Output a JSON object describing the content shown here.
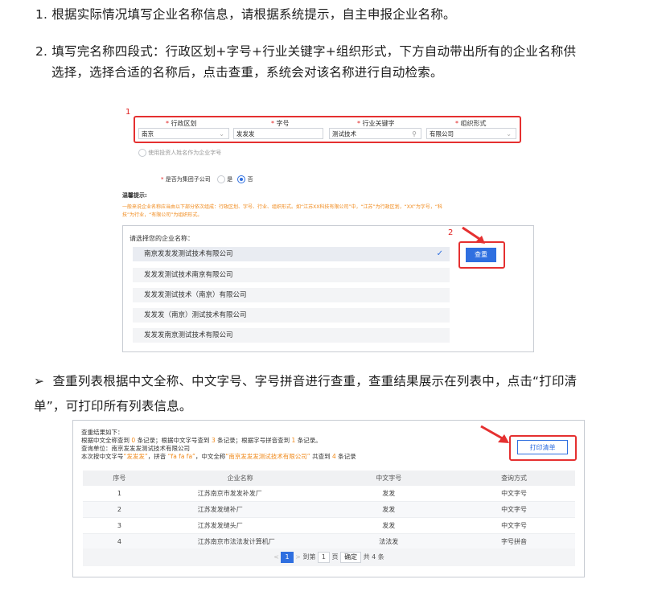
{
  "step1": "1. 根据实际情况填写企业名称信息，请根据系统提示，自主申报企业名称。",
  "step2_line1": "2. 填写完名称四段式：行政区划+字号+行业关键字+组织形式，下方自动带出所有的企业名称供",
  "step2_line2": "选择，选择合适的名称后，点击查重，系统会对该名称进行自动检索。",
  "fig1": {
    "marker1": "1",
    "marker2": "2",
    "asterisk": "*",
    "labels": [
      "行政区划",
      "字号",
      "行业关键字",
      "组织形式"
    ],
    "values": [
      "南京",
      "发发发",
      "测试技术",
      "有限公司"
    ],
    "investor_option": "使用投资人姓名作为企业字号",
    "group_label": "是否为集团子公司",
    "group_yes": "是",
    "group_no": "否",
    "tip_title": "温馨提示:",
    "tip_line1": "一般来说企业名称应当由以下部分依次组成：行政区划、字号、行业、组织形式。如“江苏XX科技有限公司”中，“江苏”为行政区划，“XX”为字号，“科",
    "tip_line2": "技”为行业，“有限公司”为组织形式。",
    "choose_label": "请选择您的企业名称：",
    "names": [
      "南京发发发测试技术有限公司",
      "发发发测试技术南京有限公司",
      "发发发测试技术（南京）有限公司",
      "发发发（南京）测试技术有限公司",
      "发发发南京测试技术有限公司"
    ],
    "check_button": "查重"
  },
  "bullet": "➢",
  "bullet_line1": "查重列表根据中文全称、中文字号、字号拼音进行查重，查重结果展示在列表中，点击“打印清",
  "bullet_line2": "单”，可打印所有列表信息。",
  "fig2": {
    "title": "查重结果如下：",
    "line2_a": "根据中文全称查到",
    "line2_n1": "0",
    "line2_b": "条记录；根据中文字号查到",
    "line2_n2": "3",
    "line2_c": "条记录；根据字号拼音查到",
    "line2_n3": "1",
    "line2_d": "条记录。",
    "unit": "查询单位：南京发发发测试技术有限公司",
    "line4_a": "本次按中文字号",
    "line4_q1": "“发发发”",
    "line4_b": "，拼音",
    "line4_q2": "“fa fa fa”",
    "line4_c": "，中文全称",
    "line4_q3": "“南京发发发测试技术有限公司”",
    "line4_d": "共查到",
    "line4_n": "4",
    "line4_e": "条记录",
    "print_button": "打印清单",
    "headers": [
      "序号",
      "企业名称",
      "中文字号",
      "查询方式"
    ],
    "rows": [
      [
        "1",
        "江苏南京市发发补发厂",
        "发发",
        "中文字号"
      ],
      [
        "2",
        "江苏发发缝补厂",
        "发发",
        "中文字号"
      ],
      [
        "3",
        "江苏发发缝头厂",
        "发发",
        "中文字号"
      ],
      [
        "4",
        "江苏南京市法法发计算机厂",
        "法法发",
        "字号拼音"
      ]
    ],
    "pager": {
      "prev": "<",
      "current": "1",
      "next": ">",
      "goto": "到第",
      "page_input": "1",
      "page_unit": "页",
      "confirm": "确定",
      "total": "共 4 条"
    }
  }
}
